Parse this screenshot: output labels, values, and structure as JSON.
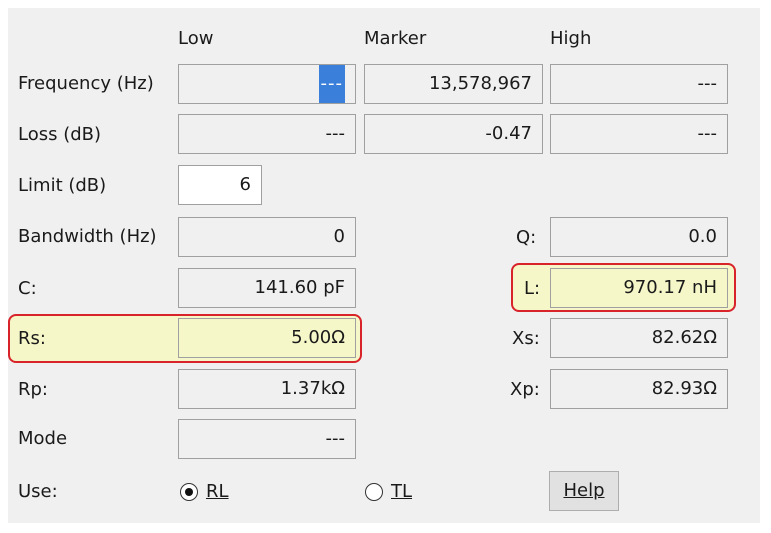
{
  "headers": {
    "low": "Low",
    "marker": "Marker",
    "high": "High"
  },
  "labels": {
    "frequency": "Frequency (Hz)",
    "loss": "Loss (dB)",
    "limit": "Limit (dB)",
    "bandwidth": "Bandwidth (Hz)",
    "q": "Q:",
    "c": "C:",
    "l": "L:",
    "rs": "Rs:",
    "xs": "Xs:",
    "rp": "Rp:",
    "xp": "Xp:",
    "mode": "Mode",
    "use": "Use:"
  },
  "values": {
    "frequency_low": "---",
    "frequency_marker": "13,578,967",
    "frequency_high": "---",
    "loss_low": "---",
    "loss_marker": "-0.47",
    "loss_high": "---",
    "limit": "6",
    "bandwidth": "0",
    "q": "0.0",
    "c": "141.60 pF",
    "l": "970.17 nH",
    "rs": "5.00Ω",
    "xs": "82.62Ω",
    "rp": "1.37kΩ",
    "xp": "82.93Ω",
    "mode": "---"
  },
  "use": {
    "rl_label": "RL",
    "tl_label": "TL",
    "selected": "RL"
  },
  "help_label": "Help",
  "colors": {
    "highlight_border": "#d8232a",
    "highlight_fill": "#f6f7c9",
    "selection": "#3a7fd9",
    "panel_bg": "#f0f0f0"
  }
}
